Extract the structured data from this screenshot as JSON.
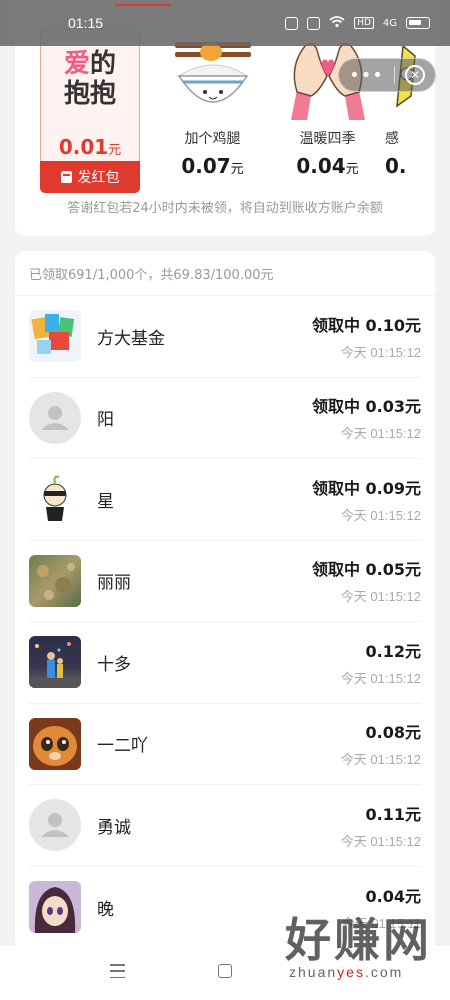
{
  "status_bar": {
    "time": "01:15",
    "net": "4G",
    "hd": "HD"
  },
  "capsule": {
    "more": "•••",
    "close": "✕"
  },
  "gifts": [
    {
      "name": "爱的抱抱",
      "price": "0.01",
      "unit": "元",
      "selected": true,
      "send_label": "发红包"
    },
    {
      "name": "加个鸡腿",
      "price": "0.07",
      "unit": "元"
    },
    {
      "name": "温暖四季",
      "price": "0.04",
      "unit": "元"
    },
    {
      "name": "感",
      "price": "0.",
      "unit": ""
    }
  ],
  "hug_text": {
    "line1_a": "爱",
    "line1_b": "的",
    "line2": "抱抱"
  },
  "notice": "答谢红包若24小时内未被领，将自动到账收方账户余额",
  "summary": "已领取691/1,000个，共69.83/100.00元",
  "records": [
    {
      "name": "方大基金",
      "amount": "领取中 0.10元",
      "time": "今天 01:15:12"
    },
    {
      "name": "阳",
      "amount": "领取中 0.03元",
      "time": "今天 01:15:12"
    },
    {
      "name": "星",
      "amount": "领取中 0.09元",
      "time": "今天 01:15:12"
    },
    {
      "name": "丽丽",
      "amount": "领取中 0.05元",
      "time": "今天 01:15:12"
    },
    {
      "name": "十多",
      "amount": "0.12元",
      "time": "今天 01:15:12"
    },
    {
      "name": "一二吖",
      "amount": "0.08元",
      "time": "今天 01:15:12"
    },
    {
      "name": "勇诚",
      "amount": "0.11元",
      "time": "今天 01:15:12"
    },
    {
      "name": "晚",
      "amount": "0.04元",
      "time": "今天 01:15:11"
    }
  ],
  "watermark": {
    "big": "好赚网",
    "small_a": "zhuan",
    "small_b": "yes",
    "small_c": ".com"
  },
  "colors": {
    "accent": "#e0392e",
    "selected_bg": "#fff2f0",
    "pink": "#ef5d86"
  }
}
